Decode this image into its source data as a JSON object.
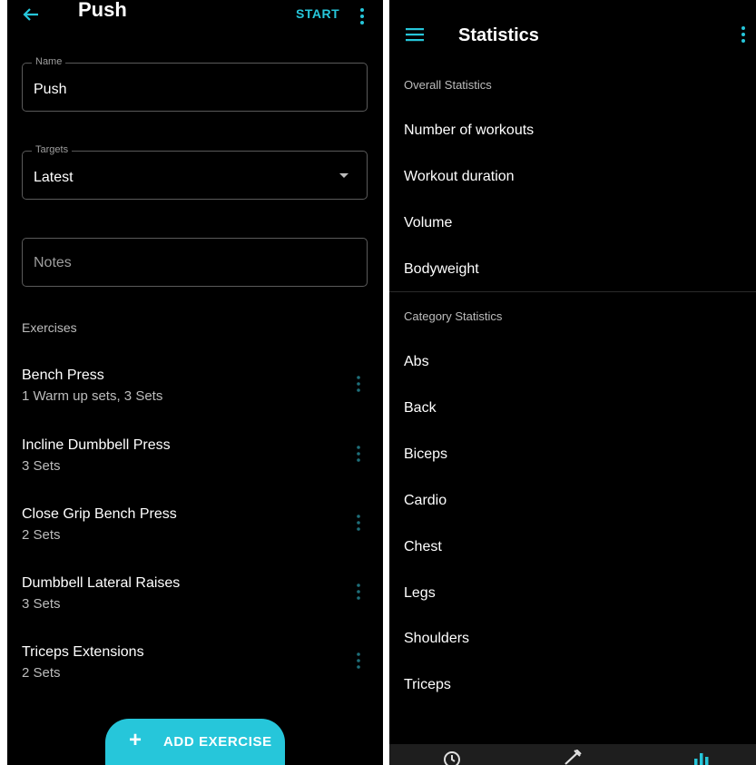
{
  "left": {
    "title": "Push",
    "start_label": "START",
    "name_field": {
      "label": "Name",
      "value": "Push"
    },
    "targets_field": {
      "label": "Targets",
      "value": "Latest"
    },
    "notes_field": {
      "placeholder": "Notes"
    },
    "exercises_header": "Exercises",
    "exercises": [
      {
        "name": "Bench Press",
        "sets": "1 Warm up sets, 3 Sets"
      },
      {
        "name": "Incline Dumbbell Press",
        "sets": "3 Sets"
      },
      {
        "name": "Close Grip Bench Press",
        "sets": "2 Sets"
      },
      {
        "name": "Dumbbell Lateral Raises",
        "sets": "3 Sets"
      },
      {
        "name": "Triceps Extensions",
        "sets": "2 Sets"
      }
    ],
    "add_exercise_label": "ADD EXERCISE",
    "icons": {
      "back": "arrow-back-icon",
      "more": "more-vert-icon",
      "add": "plus-icon",
      "dropdown": "caret-down-icon"
    }
  },
  "right": {
    "title": "Statistics",
    "overall_header": "Overall Statistics",
    "overall_items": [
      "Number of workouts",
      "Workout duration",
      "Volume",
      "Bodyweight"
    ],
    "category_header": "Category Statistics",
    "category_items": [
      "Abs",
      "Back",
      "Biceps",
      "Cardio",
      "Chest",
      "Legs",
      "Shoulders",
      "Triceps"
    ],
    "icons": {
      "menu": "hamburger-menu-icon",
      "more": "more-vert-icon",
      "nav": [
        "history-icon",
        "dumbbell-icon",
        "bar-chart-icon"
      ]
    }
  },
  "colors": {
    "accent": "#26c6da",
    "background": "#000000",
    "text": "#ffffff",
    "muted": "#bdbdbd",
    "outline": "#5a5a5a"
  }
}
